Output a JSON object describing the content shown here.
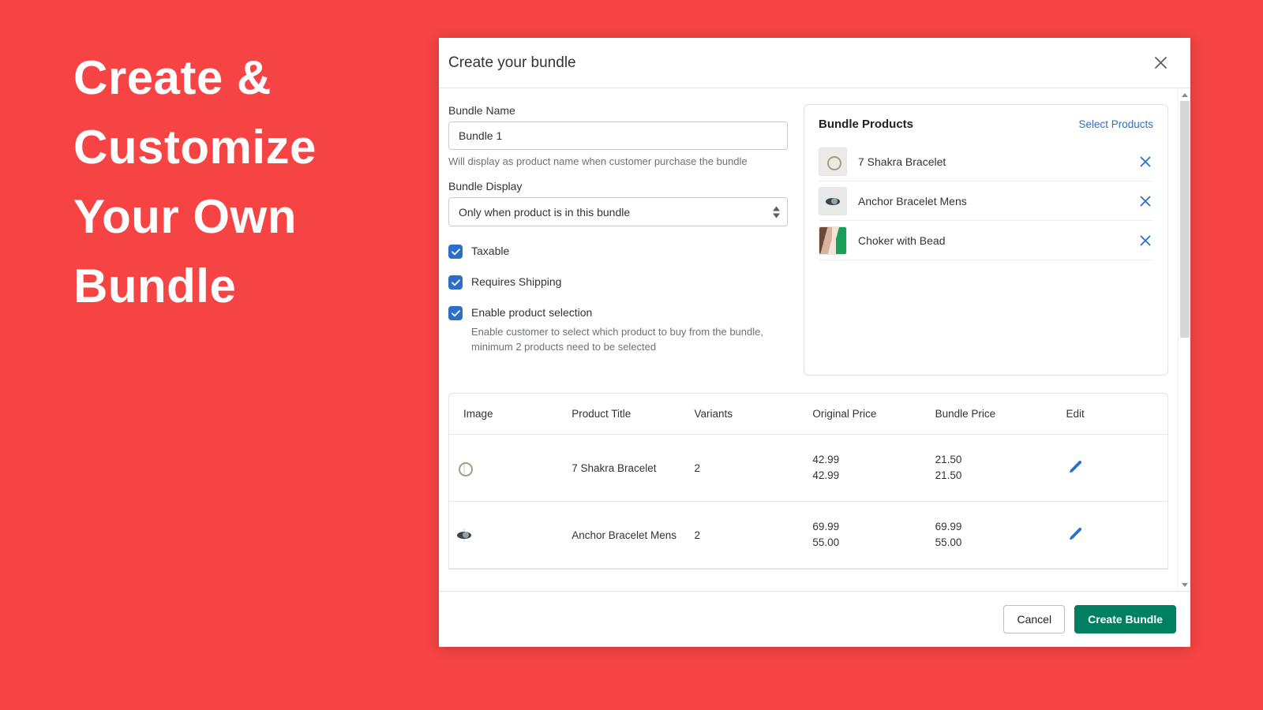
{
  "promo": {
    "lines": [
      "Create &",
      "Customize",
      "Your Own",
      "Bundle"
    ],
    "background_color": "#f54443",
    "text_color": "#ffffff"
  },
  "modal": {
    "title": "Create your bundle",
    "close_icon": "close-icon"
  },
  "form": {
    "bundle_name_label": "Bundle Name",
    "bundle_name_value": "Bundle 1",
    "bundle_name_placeholder": "Bundle 1",
    "bundle_name_help": "Will display as product name when customer purchase the bundle",
    "bundle_display_label": "Bundle Display",
    "bundle_display_value": "Only when product is in this bundle",
    "checkboxes": [
      {
        "label": "Taxable",
        "checked": true,
        "sub": ""
      },
      {
        "label": "Requires Shipping",
        "checked": true,
        "sub": ""
      },
      {
        "label": "Enable product selection",
        "checked": true,
        "sub": "Enable customer to select which product to buy from the bundle, minimum 2 products need to be selected"
      }
    ],
    "checkbox_color": "#2c6ecb"
  },
  "bundle_products": {
    "title": "Bundle Products",
    "select_link": "Select Products",
    "link_color": "#2c6ecb",
    "items": [
      {
        "name": "7 Shakra Bracelet",
        "thumb": "ring-thumbnail",
        "remove_icon": "close-icon"
      },
      {
        "name": "Anchor Bracelet Mens",
        "thumb": "anchor-thumbnail",
        "remove_icon": "close-icon"
      },
      {
        "name": "Choker with Bead",
        "thumb": "choker-thumbnail",
        "remove_icon": "close-icon"
      }
    ]
  },
  "table": {
    "headers": [
      "Image",
      "Product Title",
      "Variants",
      "Original Price",
      "Bundle Price",
      "Edit"
    ],
    "rows": [
      {
        "thumb": "ring-thumbnail",
        "title": "7 Shakra Bracelet",
        "variants": "2",
        "original_price_1": "42.99",
        "original_price_2": "42.99",
        "bundle_price_1": "21.50",
        "bundle_price_2": "21.50",
        "edit_icon": "pencil-icon"
      },
      {
        "thumb": "anchor-thumbnail",
        "title": "Anchor Bracelet Mens",
        "variants": "2",
        "original_price_1": "69.99",
        "original_price_2": "55.00",
        "bundle_price_1": "69.99",
        "bundle_price_2": "55.00",
        "edit_icon": "pencil-icon"
      }
    ]
  },
  "footer": {
    "cancel_label": "Cancel",
    "primary_label": "Create Bundle",
    "primary_color": "#008060"
  },
  "scrollbar": {
    "up_arrow": "chevron-up-icon",
    "down_arrow": "chevron-down-icon"
  }
}
